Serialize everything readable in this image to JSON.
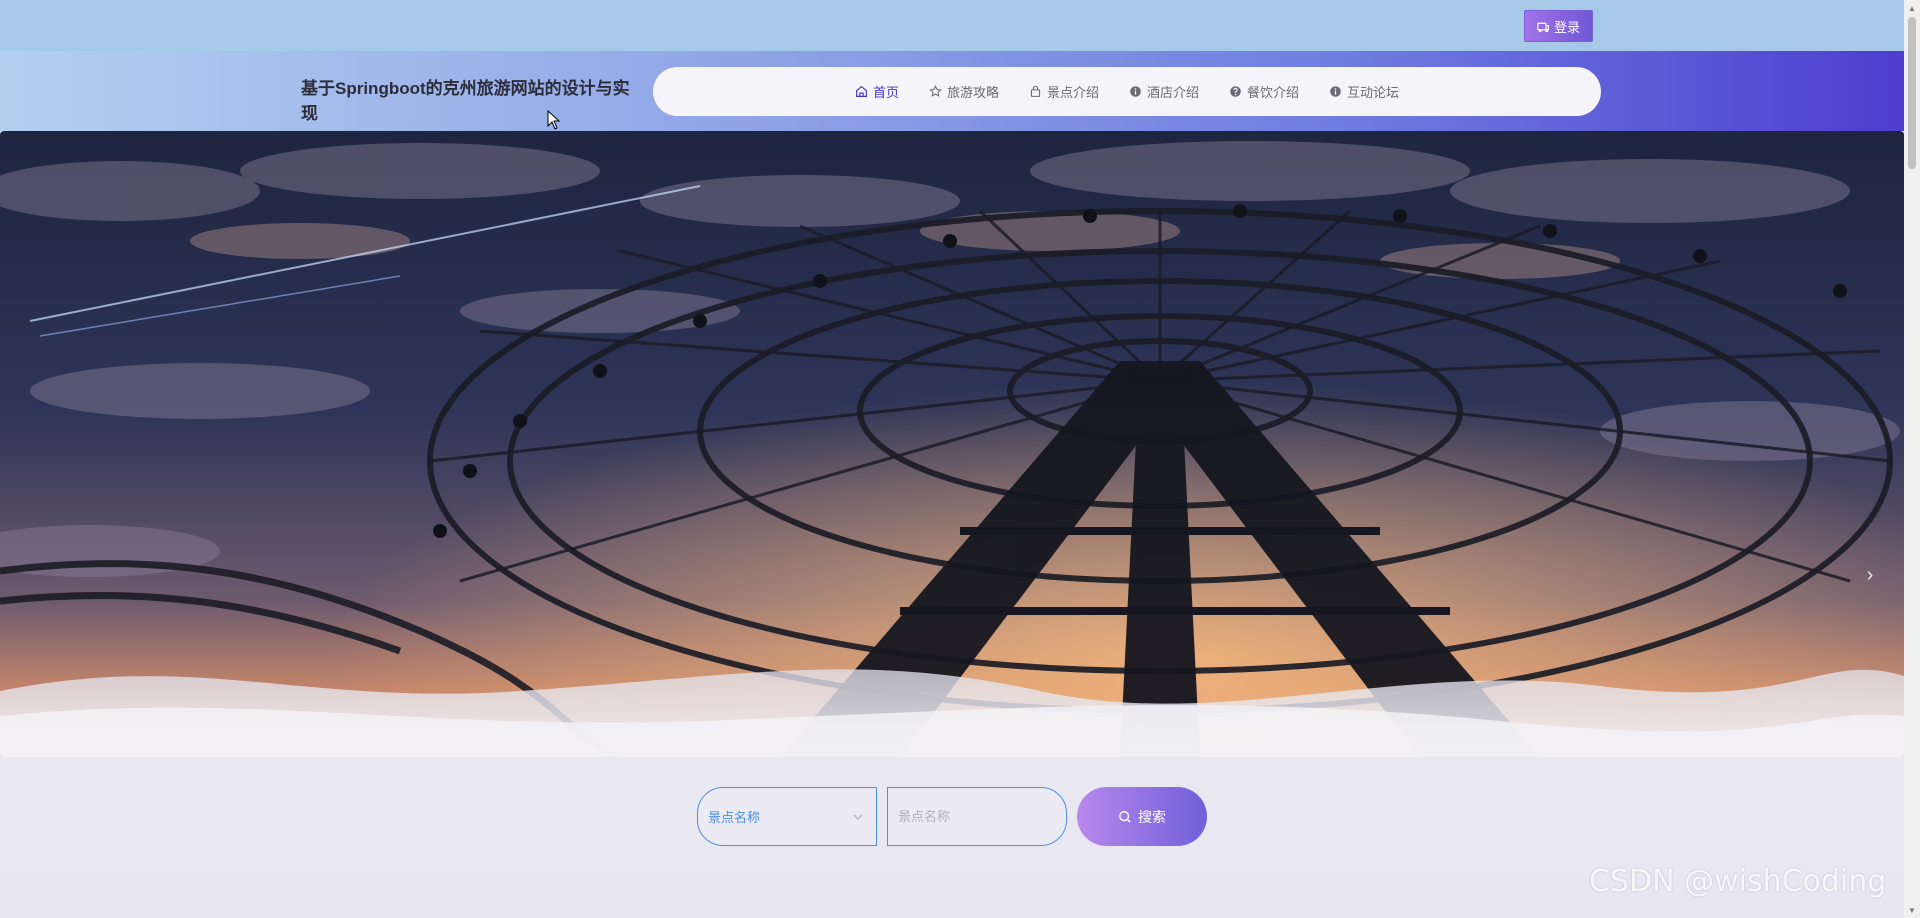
{
  "topbar": {
    "login_label": "登录"
  },
  "header": {
    "site_title": "基于Springboot的克州旅游网站的设计与实现"
  },
  "nav": {
    "items": [
      {
        "label": "首页",
        "icon": "home-icon",
        "active": true
      },
      {
        "label": "旅游攻略",
        "icon": "star-icon",
        "active": false
      },
      {
        "label": "景点介绍",
        "icon": "bag-icon",
        "active": false
      },
      {
        "label": "酒店介绍",
        "icon": "info-icon",
        "active": false
      },
      {
        "label": "餐饮介绍",
        "icon": "question-icon",
        "active": false
      },
      {
        "label": "互动论坛",
        "icon": "info-icon",
        "active": false
      }
    ]
  },
  "banner": {
    "next_icon": "chevron-right-icon"
  },
  "search": {
    "select_value": "景点名称",
    "input_placeholder": "景点名称",
    "button_label": "搜索"
  },
  "watermark": "CSDN @wishCoding",
  "colors": {
    "accent": "#4533c6",
    "search_border": "#4d8fe0"
  }
}
